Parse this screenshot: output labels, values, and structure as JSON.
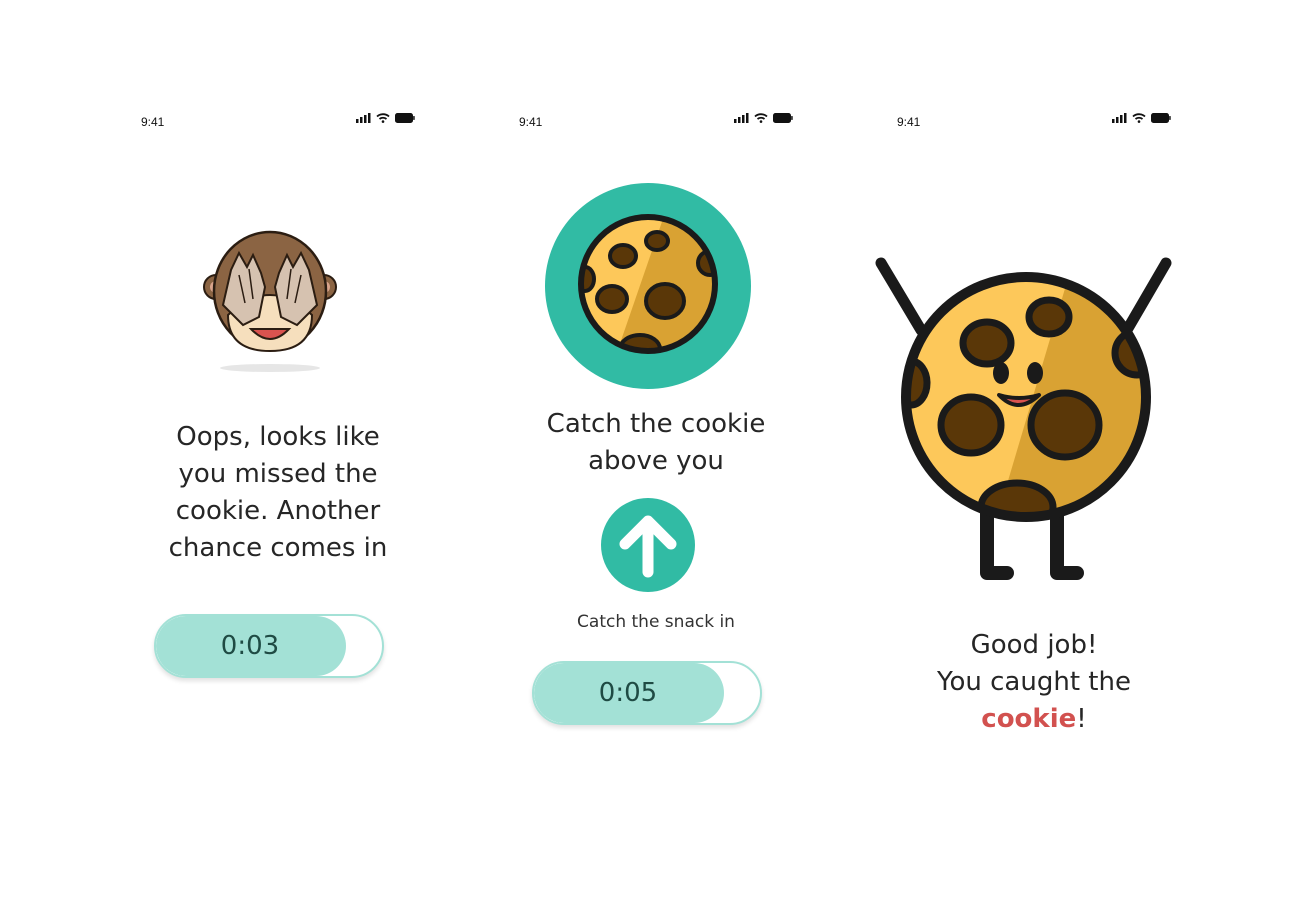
{
  "screens": [
    {
      "time": "9:41",
      "message_lines": [
        "Oops, looks like",
        "you missed the",
        "cookie. Another",
        "chance comes in"
      ],
      "timer": {
        "value": "0:03",
        "fill": 0.84
      },
      "illustration": "monkey-covering-eyes-icon"
    },
    {
      "time": "9:41",
      "message_lines": [
        "Catch the cookie",
        "above you"
      ],
      "caption": "Catch the snack in",
      "timer": {
        "value": "0:05",
        "fill": 0.84
      },
      "illustration": "cookie-in-circle-icon",
      "arrow": "arrow-up-icon"
    },
    {
      "time": "9:41",
      "message_lines": [
        "Good job!",
        "You caught the"
      ],
      "highlight_word": "cookie",
      "highlight_suffix": "!",
      "illustration": "happy-cookie-character-icon"
    }
  ],
  "colors": {
    "teal": "#31bba4",
    "timer_fill": "#a3e1d6",
    "cookie_light": "#fdc85a",
    "cookie_dark": "#d9a233",
    "chip": "#5a3708",
    "highlight": "#d2514f"
  }
}
